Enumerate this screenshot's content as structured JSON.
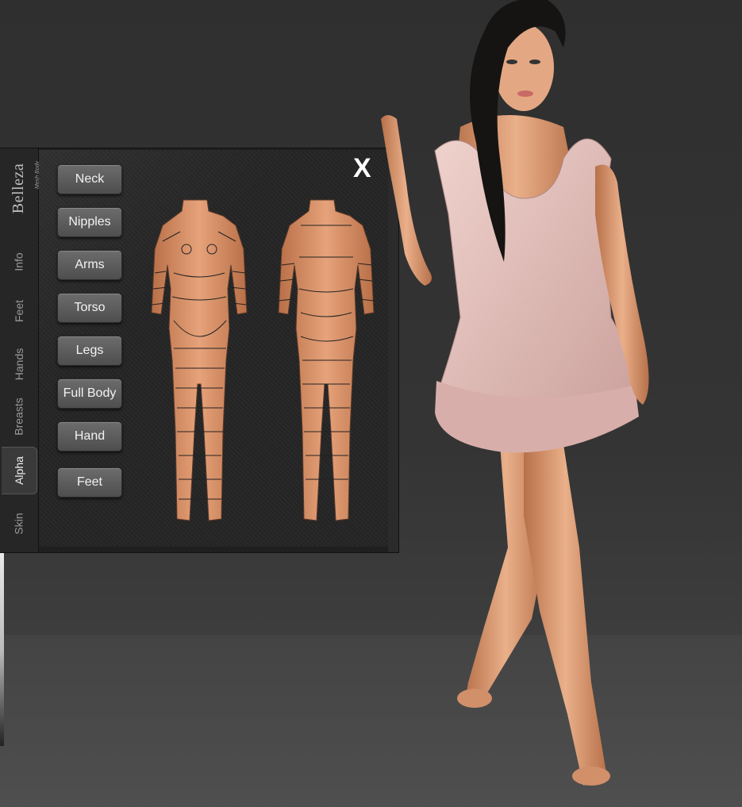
{
  "hud": {
    "logo": "Belleza",
    "logo_sub": "Mesh Body",
    "close_label": "X",
    "tabs": [
      "Info",
      "Feet",
      "Hands",
      "Breasts",
      "Alpha",
      "Skin"
    ],
    "active_tab": "Alpha",
    "buttons": [
      "Neck",
      "Nipples",
      "Arms",
      "Torso",
      "Legs",
      "Full Body",
      "Hand",
      "Feet"
    ]
  },
  "colors": {
    "background": "#333333",
    "skin": "#d99b6e",
    "dress": "#e3bfba"
  }
}
